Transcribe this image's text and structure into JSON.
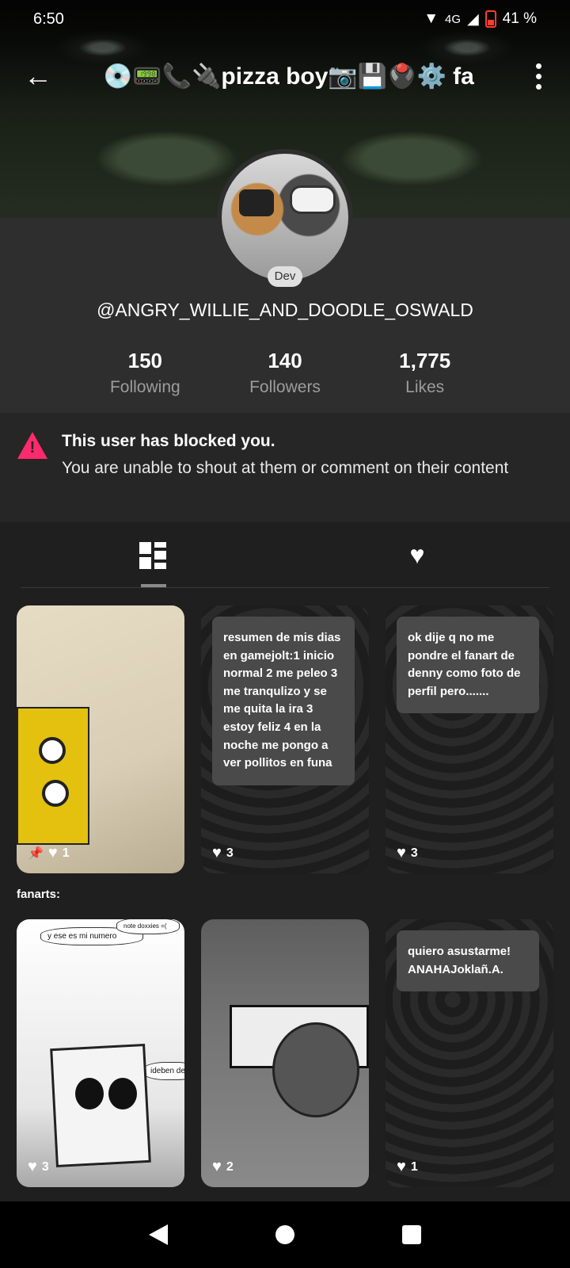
{
  "status_bar": {
    "time": "6:50",
    "network": "4G",
    "battery": "41 %"
  },
  "app_bar": {
    "title": "💿📟📞🔌pizza boy📷💾🖲️⚙️ fa"
  },
  "profile": {
    "badge": "Dev",
    "username": "@ANGRY_WILLIE_AND_DOODLE_OSWALD",
    "stats": [
      {
        "value": "150",
        "label": "Following"
      },
      {
        "value": "140",
        "label": "Followers"
      },
      {
        "value": "1,775",
        "label": "Likes"
      }
    ]
  },
  "blocked_notice": {
    "title": "This user has blocked you.",
    "message": "You are unable to shout at them or comment on their content"
  },
  "tabs": [
    {
      "name": "posts",
      "icon": "grid-icon",
      "active": true
    },
    {
      "name": "likes",
      "icon": "heart-icon",
      "active": false
    }
  ],
  "posts": [
    {
      "type": "image",
      "likes": "1",
      "pinned": true
    },
    {
      "type": "text",
      "text": "resumen de mis dias en gamejolt:1 inicio normal 2 me peleo 3 me tranqulizo y se me quita la ira 3 estoy feliz 4 en la noche me pongo a ver pollitos en funa",
      "likes": "3"
    },
    {
      "type": "text",
      "text": "ok dije q no me pondre el fanart de denny como foto de perfil pero.......",
      "likes": "3"
    },
    {
      "type": "image",
      "likes": "3",
      "bubbles": [
        "y ese es mi numero",
        "note doxxies =(",
        "ideben de"
      ]
    },
    {
      "type": "image",
      "likes": "2"
    },
    {
      "type": "text",
      "text": "quiero asustarme! ANAHAJoklañ.A.",
      "likes": "1"
    }
  ],
  "section_label": "fanarts:",
  "colors": {
    "accent_warning": "#ff2a6d",
    "background": "#1f1f1f",
    "sheet": "#2e2e2e"
  }
}
